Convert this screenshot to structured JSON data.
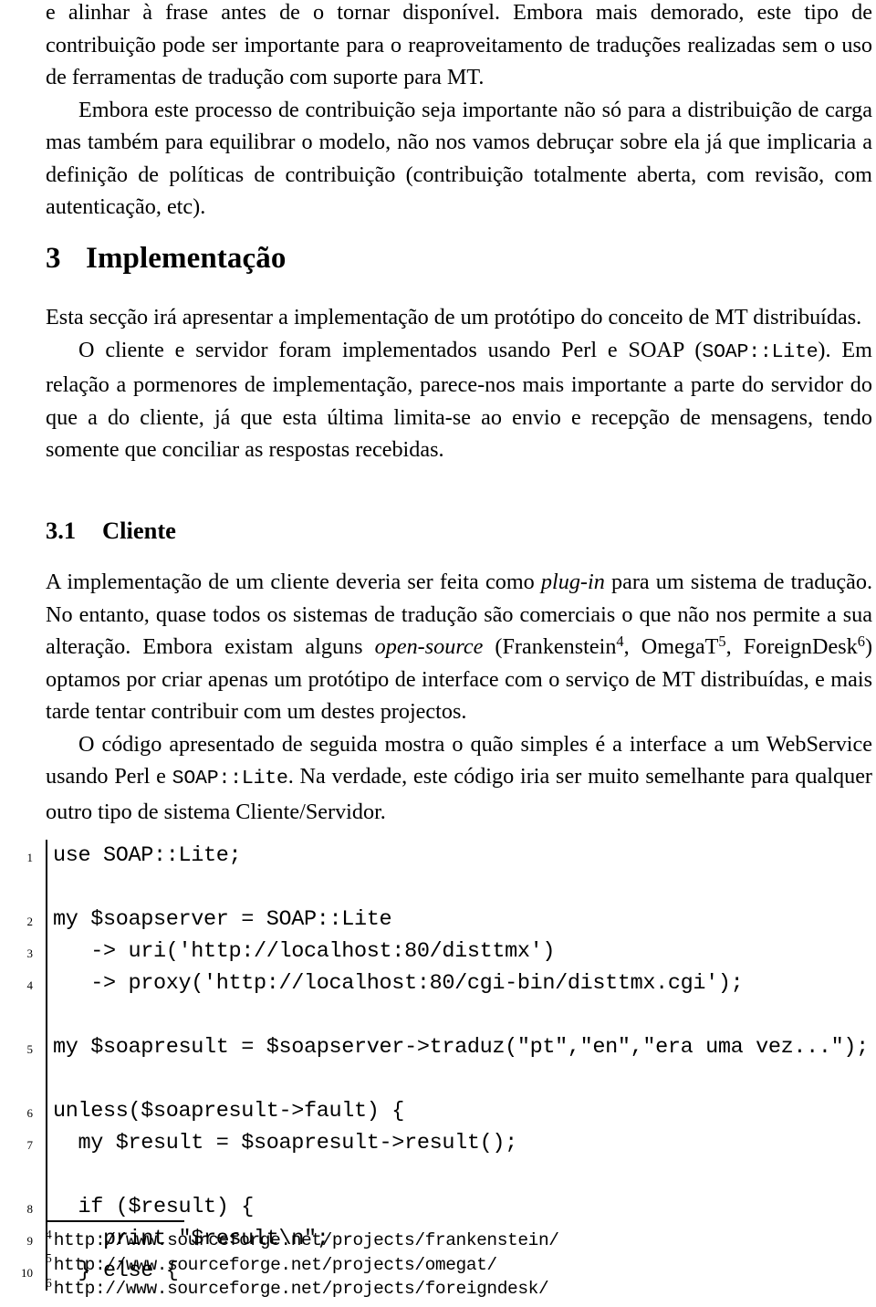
{
  "document": {
    "type": "academic-paper-page",
    "language": "pt-PT"
  },
  "body": {
    "paragraph_1": {
      "run_1": "e alinhar à frase antes de o tornar disponível. Embora mais demorado, este tipo de contribuição pode ser importante para o reaproveitamento de traduções realizadas sem o uso de ferramentas de tradução com suporte para MT."
    },
    "paragraph_2": {
      "run_1": "Embora este processo de contribuição seja importante não só para a distribuição de carga mas também para equilibrar o modelo, não nos vamos debruçar sobre ela já que implicaria a definição de políticas de contribuição (contribuição totalmente aberta, com revisão, com autenticação, etc)."
    }
  },
  "section": {
    "number": "3",
    "title": "Implementação",
    "paragraph_1": {
      "run_1": "Esta secção irá apresentar a implementação de um protótipo do conceito de MT distribuídas."
    },
    "paragraph_2": {
      "run_1": "O cliente e servidor foram implementados usando Perl e SOAP (",
      "run_2_code": "SOAP::Lite",
      "run_3": "). Em relação a pormenores de implementação, parece-nos mais importante a parte do servidor do que a do cliente, já que esta última limita-se ao envio e recepção de mensagens, tendo somente que conciliar as respostas recebidas."
    }
  },
  "subsection": {
    "number": "3.1",
    "title": "Cliente",
    "paragraph_1": {
      "run_1": "A implementação de um cliente deveria ser feita como ",
      "run_2_italic": "plug-in",
      "run_3": " para um sistema de tradução. No entanto, quase todos os sistemas de tradução são comerciais o que não nos permite a sua alteração. Embora existam alguns ",
      "run_4_italic": "open-source",
      "run_5": " (Frankenstein",
      "run_6_sup": "4",
      "run_7": ", OmegaT",
      "run_8_sup": "5",
      "run_9": ", ForeignDesk",
      "run_10_sup": "6",
      "run_11": ") optamos por criar apenas um protótipo de interface com o serviço de MT distribuídas, e mais tarde tentar contribuir com um destes projectos."
    },
    "paragraph_2": {
      "run_1": "O código apresentado de seguida mostra o quão simples é a interface a um WebService usando Perl e ",
      "run_2_code": "SOAP::Lite",
      "run_3": ". Na verdade, este código iria ser muito semelhante para qualquer outro tipo de sistema Cliente/Servidor."
    }
  },
  "code_listing": {
    "language": "perl",
    "lines": [
      {
        "number": "1",
        "text": "use SOAP::Lite;"
      },
      {
        "number": "",
        "text": ""
      },
      {
        "number": "2",
        "text": "my $soapserver = SOAP::Lite"
      },
      {
        "number": "3",
        "text": "   -> uri('http://localhost:80/disttmx')"
      },
      {
        "number": "4",
        "text": "   -> proxy('http://localhost:80/cgi-bin/disttmx.cgi');"
      },
      {
        "number": "",
        "text": ""
      },
      {
        "number": "5",
        "text": "my $soapresult = $soapserver->traduz(\"pt\",\"en\",\"era uma vez...\");"
      },
      {
        "number": "",
        "text": ""
      },
      {
        "number": "6",
        "text": "unless($soapresult->fault) {"
      },
      {
        "number": "7",
        "text": "  my $result = $soapresult->result();"
      },
      {
        "number": "",
        "text": ""
      },
      {
        "number": "8",
        "text": "  if ($result) {"
      },
      {
        "number": "9",
        "text": "    print \"$result\\n\";"
      },
      {
        "number": "10",
        "text": "  } else {"
      }
    ]
  },
  "footnotes": [
    {
      "mark": "4",
      "url": "http://www.sourceforge.net/projects/frankenstein/"
    },
    {
      "mark": "5",
      "url": "http://www.sourceforge.net/projects/omegat/"
    },
    {
      "mark": "6",
      "url": "http://www.sourceforge.net/projects/foreigndesk/"
    }
  ]
}
